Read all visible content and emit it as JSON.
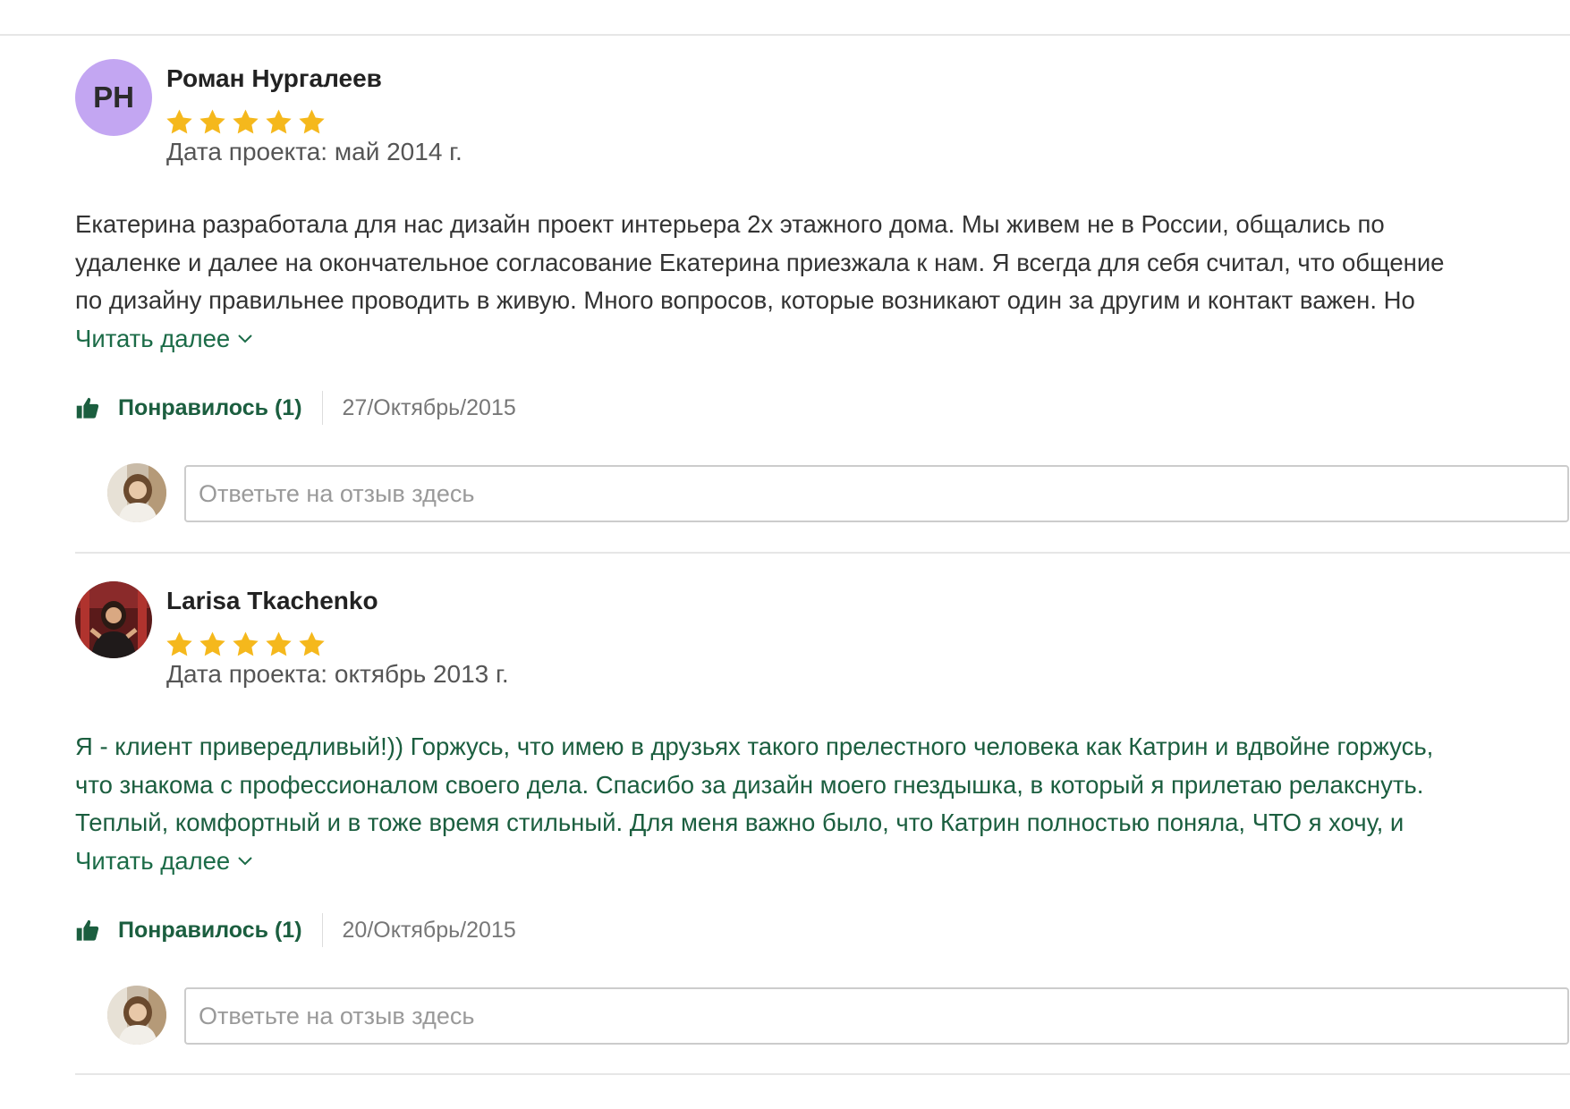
{
  "reviews": [
    {
      "initials": "РН",
      "author": "Роман Нургалеев",
      "rating": 5,
      "project_date": "Дата проекта: май 2014 г.",
      "lines": [
        "Екатерина разработала для нас дизайн проект интерьера 2х этажного дома. Мы живем не в России, общались по",
        "удаленке и далее на окончательное согласование Екатерина приезжала к нам. Я всегда для себя считал, что общение",
        "по дизайну правильнее проводить в живую. Много вопросов, которые возникают один за другим и контакт важен. Но"
      ],
      "read_more": "Читать далее",
      "like_label": "Понравилось (1)",
      "date": "27/Октябрь/2015",
      "reply_placeholder": "Ответьте на отзыв здесь"
    },
    {
      "initials": "",
      "author": "Larisa Tkachenko",
      "rating": 5,
      "project_date": "Дата проекта: октябрь 2013 г.",
      "lines": [
        "Я - клиент привередливый!)) Горжусь, что имею в друзьях такого прелестного человека как Катрин и вдвойне горжусь,",
        "что знакома с профессионалом своего дела. Спасибо за дизайн моего гнездышка, в который я прилетаю релакснуть.",
        "Теплый, комфортный и в тоже время стильный. Для меня важно было, что Катрин полностью поняла, ЧТО я хочу, и"
      ],
      "read_more": "Читать далее",
      "like_label": "Понравилось (1)",
      "date": "20/Октябрь/2015",
      "reply_placeholder": "Ответьте на отзыв здесь"
    }
  ],
  "colors": {
    "star": "#f5b81c",
    "accent_green": "#1b5e3f",
    "initials_avatar_bg": "#c3a6f2"
  },
  "icons": {
    "star": "star-icon",
    "like": "thumbs-up-icon",
    "read_more": "chevron-down-icon"
  }
}
